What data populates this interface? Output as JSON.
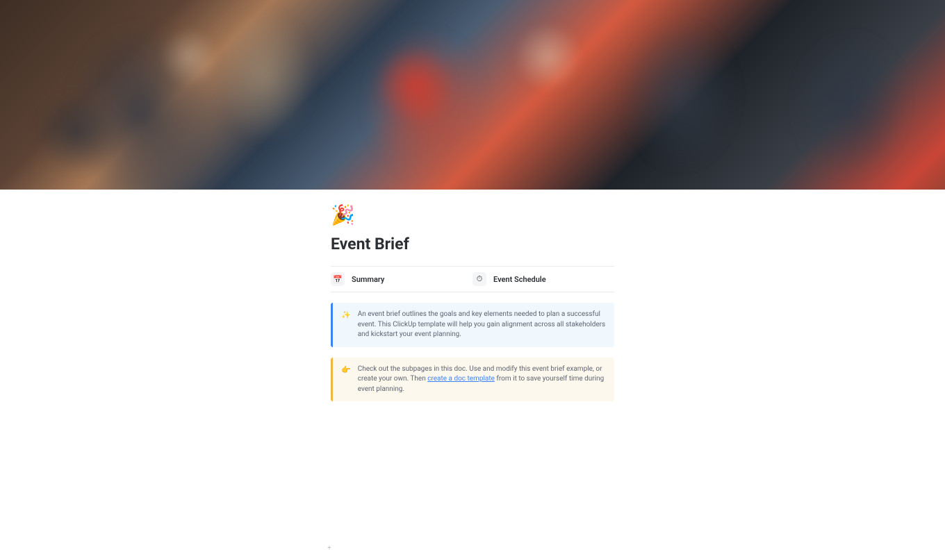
{
  "page": {
    "icon": "🎉",
    "title": "Event Brief"
  },
  "nav": {
    "items": [
      {
        "icon": "📅",
        "label": "Summary"
      },
      {
        "icon": "⏱",
        "label": "Event Schedule"
      }
    ]
  },
  "callouts": {
    "blue": {
      "icon": "✨",
      "text": "An event brief outlines the goals and key elements needed to plan a successful event. This ClickUp template will help you gain alignment across all stakeholders and kickstart your event planning."
    },
    "yellow": {
      "icon": "👉",
      "text_before": "Check out the subpages in this doc. Use and modify this event brief example, or create your own. Then ",
      "link_text": "create a doc template",
      "text_after": " from it to save yourself time during event planning."
    }
  }
}
